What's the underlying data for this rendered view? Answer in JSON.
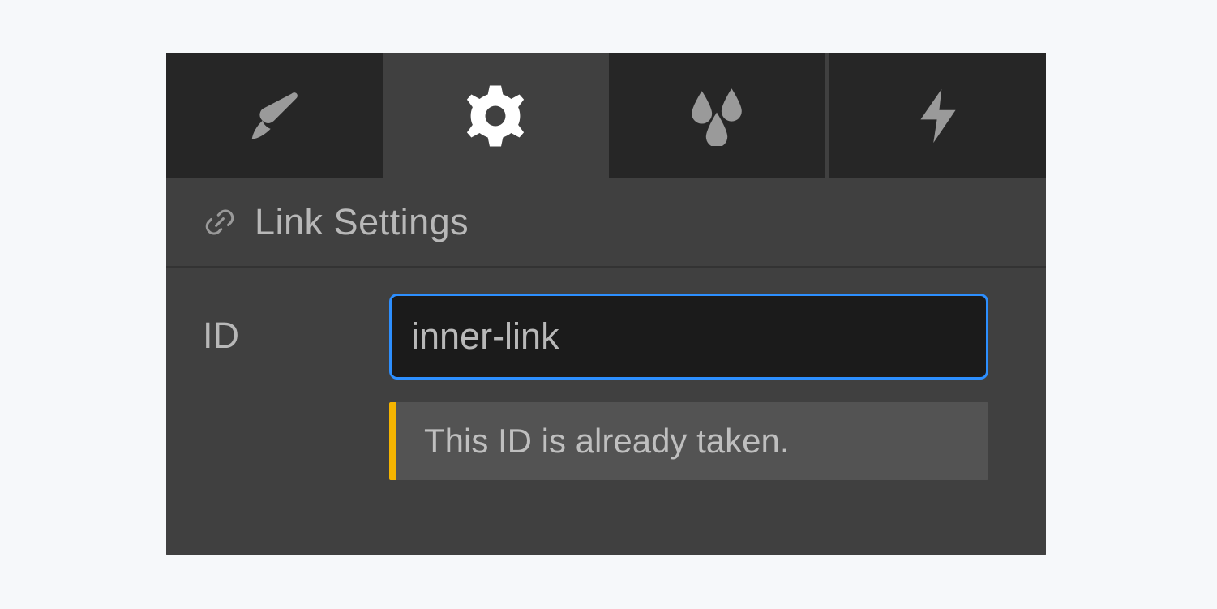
{
  "tabs": {
    "brush": {
      "icon": "brush-icon",
      "selected": false
    },
    "settings": {
      "icon": "gear-icon",
      "selected": true
    },
    "effects": {
      "icon": "drops-icon",
      "selected": false
    },
    "actions": {
      "icon": "bolt-icon",
      "selected": false
    }
  },
  "section": {
    "title": "Link Settings"
  },
  "fields": {
    "id": {
      "label": "ID",
      "value": "inner-link",
      "warning": "This ID is already taken."
    }
  },
  "colors": {
    "focus_border": "#2d8fff",
    "warning_accent": "#f5b400"
  }
}
